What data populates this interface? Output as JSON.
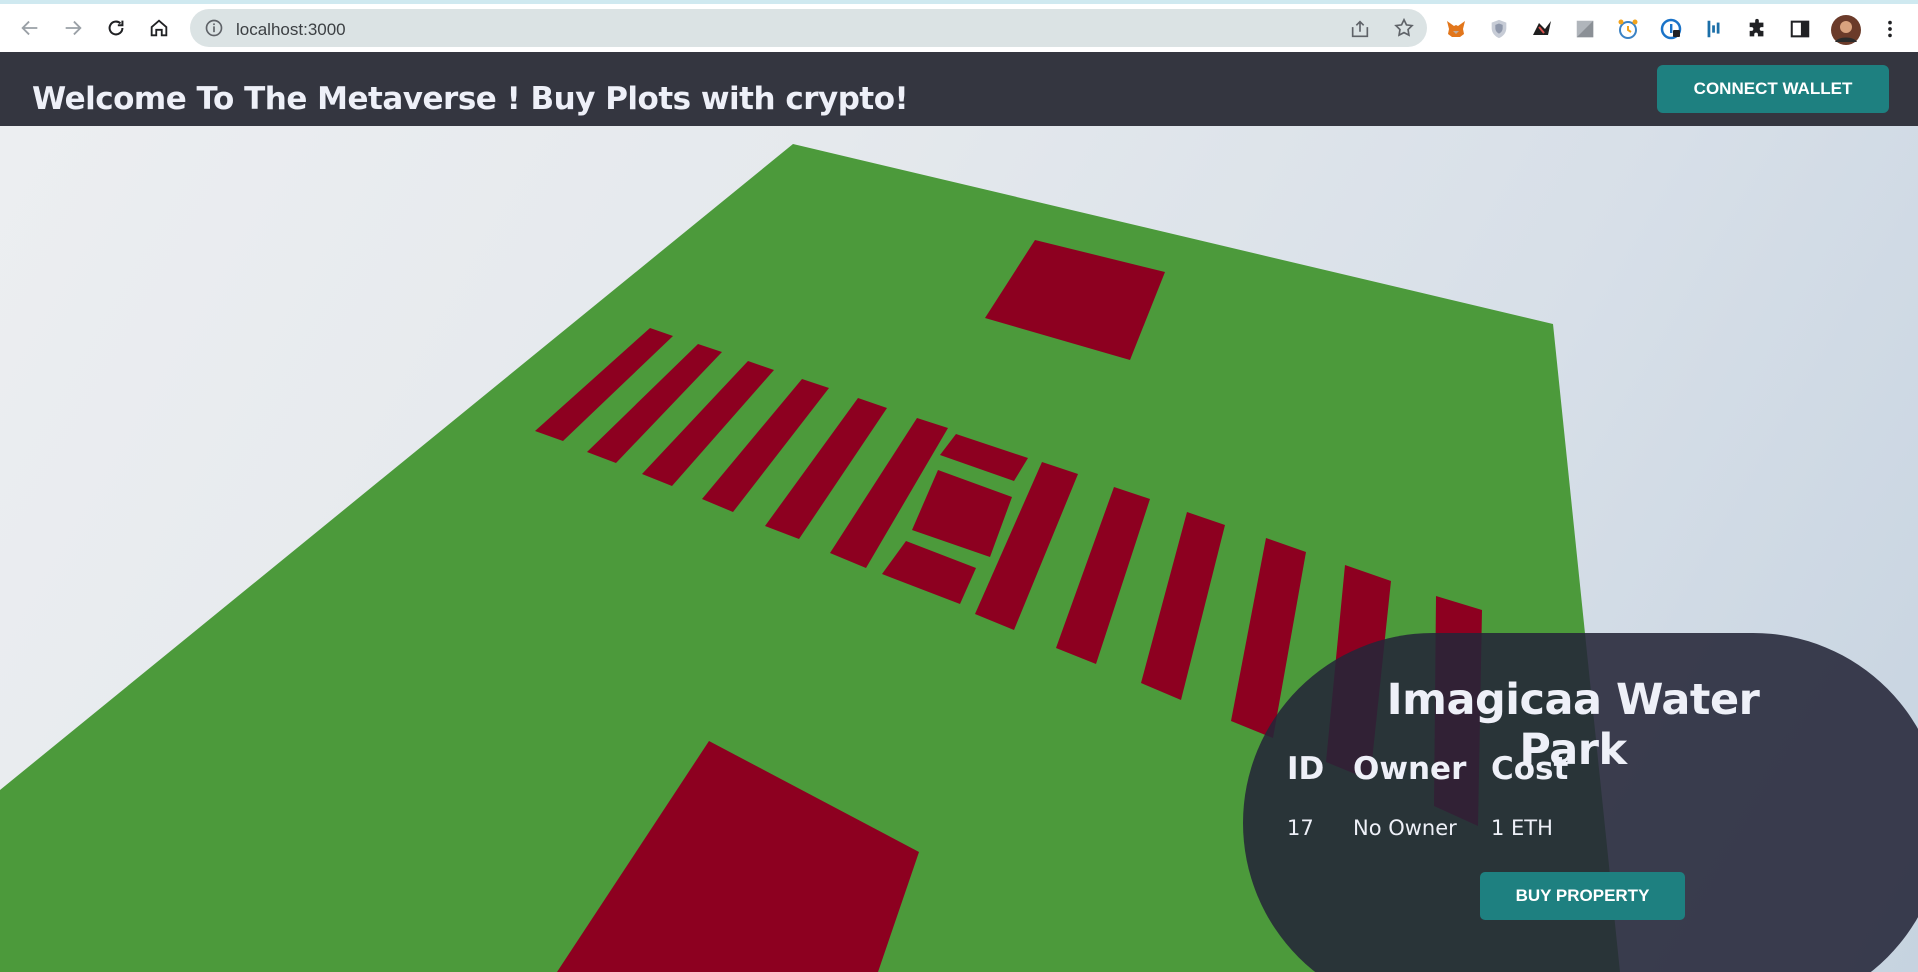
{
  "browser": {
    "url": "localhost:3000"
  },
  "header": {
    "title": "Welcome To The Metaverse ! Buy Plots with crypto!",
    "connect_wallet_label": "CONNECT WALLET"
  },
  "property": {
    "name": "Imagicaa Water Park",
    "columns": [
      "ID",
      "Owner",
      "Cost"
    ],
    "values": [
      "17",
      "No Owner",
      "1 ETH"
    ],
    "buy_label": "BUY PROPERTY"
  },
  "colors": {
    "ground": "#4c9a3b",
    "plot": "#8d0020",
    "header_bg": "#343640",
    "accent": "#1e8080"
  }
}
